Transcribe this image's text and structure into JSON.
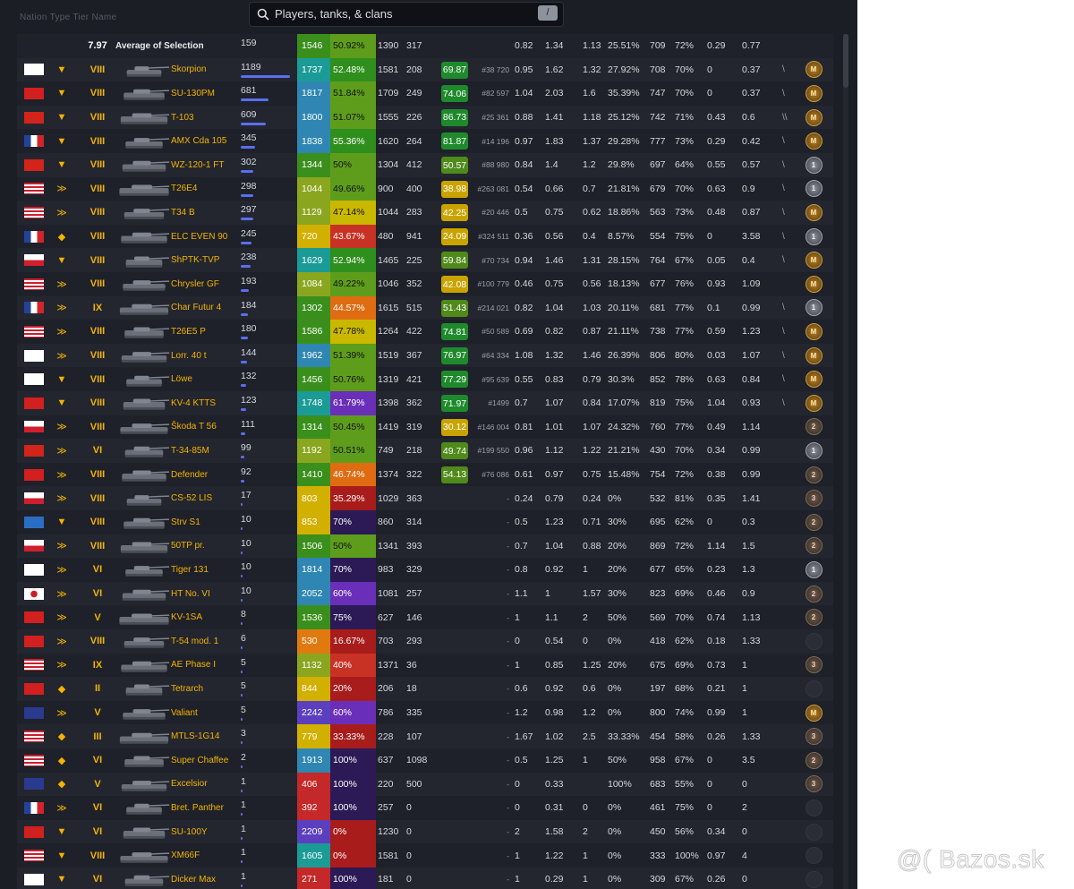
{
  "header": {
    "faint_text": "Nation  Type  Tier  Name",
    "search_placeholder": "Players, tanks, & clans",
    "search_shortcut": "/"
  },
  "average": {
    "tier": "7.97",
    "label": "Average of Selection",
    "battles": "159",
    "wn8": "1546",
    "winrate": "50.92%",
    "dmg": "1390",
    "xp": "317",
    "s1": "0.82",
    "s2": "1.34",
    "s3": "1.13",
    "s4": "25.51%",
    "s5": "709",
    "s6": "72%",
    "s7": "0.29",
    "s8": "0.77"
  },
  "watermark": "@( Bazos.sk",
  "rows": [
    {
      "flag": "ger",
      "cls": "heavy",
      "tier": "VIII",
      "name": "Skorpion",
      "battles": "1189",
      "bar": 1.0,
      "wn8": "1737",
      "wr": "52.48%",
      "dmg": "1581",
      "xp": "208",
      "moe": "69.87",
      "rank": "#38 720",
      "s1": "0.95",
      "s2": "1.62",
      "s3": "1.32",
      "s4": "27.92%",
      "s5": "708",
      "s6": "70%",
      "s7": "0",
      "s8": "0.37",
      "ind": "\\",
      "medal": "gold",
      "mlabel": "M"
    },
    {
      "flag": "ussr",
      "cls": "heavy",
      "tier": "VIII",
      "name": "SU-130PM",
      "battles": "681",
      "bar": 0.57,
      "wn8": "1817",
      "wr": "51.84%",
      "dmg": "1709",
      "xp": "249",
      "moe": "74.06",
      "rank": "#82 597",
      "s1": "1.04",
      "s2": "2.03",
      "s3": "1.6",
      "s4": "35.39%",
      "s5": "747",
      "s6": "70%",
      "s7": "0",
      "s8": "0.37",
      "ind": "\\",
      "medal": "gold",
      "mlabel": "M"
    },
    {
      "flag": "china",
      "cls": "heavy",
      "tier": "VIII",
      "name": "T-103",
      "battles": "609",
      "bar": 0.51,
      "wn8": "1800",
      "wr": "51.07%",
      "dmg": "1555",
      "xp": "226",
      "moe": "86.73",
      "rank": "#25 361",
      "s1": "0.88",
      "s2": "1.41",
      "s3": "1.18",
      "s4": "25.12%",
      "s5": "742",
      "s6": "71%",
      "s7": "0.43",
      "s8": "0.6",
      "ind": "\\\\",
      "medal": "gold",
      "mlabel": "M"
    },
    {
      "flag": "france",
      "cls": "heavy",
      "tier": "VIII",
      "name": "AMX Cda 105",
      "battles": "345",
      "bar": 0.29,
      "wn8": "1838",
      "wr": "55.36%",
      "dmg": "1620",
      "xp": "264",
      "moe": "81.87",
      "rank": "#14 196",
      "s1": "0.97",
      "s2": "1.83",
      "s3": "1.37",
      "s4": "29.28%",
      "s5": "777",
      "s6": "73%",
      "s7": "0.29",
      "s8": "0.42",
      "ind": "\\",
      "medal": "gold",
      "mlabel": "M"
    },
    {
      "flag": "china",
      "cls": "heavy",
      "tier": "VIII",
      "name": "WZ-120-1 FT",
      "battles": "302",
      "bar": 0.25,
      "wn8": "1344",
      "wr": "50%",
      "dmg": "1304",
      "xp": "412",
      "moe": "50.57",
      "rank": "#88 980",
      "s1": "0.84",
      "s2": "1.4",
      "s3": "1.2",
      "s4": "29.8%",
      "s5": "697",
      "s6": "64%",
      "s7": "0.55",
      "s8": "0.57",
      "ind": "\\",
      "medal": "silver",
      "mlabel": "1"
    },
    {
      "flag": "usa",
      "cls": "medium",
      "tier": "VIII",
      "name": "T26E4",
      "battles": "298",
      "bar": 0.25,
      "wn8": "1044",
      "wr": "49.66%",
      "dmg": "900",
      "xp": "400",
      "moe": "38.98",
      "rank": "#263 081",
      "s1": "0.54",
      "s2": "0.66",
      "s3": "0.7",
      "s4": "21.81%",
      "s5": "679",
      "s6": "70%",
      "s7": "0.63",
      "s8": "0.9",
      "ind": "\\",
      "medal": "silver",
      "mlabel": "1"
    },
    {
      "flag": "usa",
      "cls": "medium",
      "tier": "VIII",
      "name": "T34 B",
      "battles": "297",
      "bar": 0.25,
      "wn8": "1129",
      "wr": "47.14%",
      "dmg": "1044",
      "xp": "283",
      "moe": "42.25",
      "rank": "#20 446",
      "s1": "0.5",
      "s2": "0.75",
      "s3": "0.62",
      "s4": "18.86%",
      "s5": "563",
      "s6": "73%",
      "s7": "0.48",
      "s8": "0.87",
      "ind": "\\",
      "medal": "gold",
      "mlabel": "M"
    },
    {
      "flag": "france",
      "cls": "light",
      "tier": "VIII",
      "name": "ELC EVEN 90",
      "battles": "245",
      "bar": 0.21,
      "wn8": "720",
      "wr": "43.67%",
      "dmg": "480",
      "xp": "941",
      "moe": "24.09",
      "rank": "#324 511",
      "s1": "0.36",
      "s2": "0.56",
      "s3": "0.4",
      "s4": "8.57%",
      "s5": "554",
      "s6": "75%",
      "s7": "0",
      "s8": "3.58",
      "ind": "\\",
      "medal": "silver",
      "mlabel": "1"
    },
    {
      "flag": "czech",
      "cls": "heavy",
      "tier": "VIII",
      "name": "ShPTK-TVP",
      "battles": "238",
      "bar": 0.2,
      "wn8": "1629",
      "wr": "52.94%",
      "dmg": "1465",
      "xp": "225",
      "moe": "59.84",
      "rank": "#70 734",
      "s1": "0.94",
      "s2": "1.46",
      "s3": "1.31",
      "s4": "28.15%",
      "s5": "764",
      "s6": "67%",
      "s7": "0.05",
      "s8": "0.4",
      "ind": "\\",
      "medal": "gold",
      "mlabel": "M"
    },
    {
      "flag": "usa",
      "cls": "medium",
      "tier": "VIII",
      "name": "Chrysler GF",
      "battles": "193",
      "bar": 0.16,
      "wn8": "1084",
      "wr": "49.22%",
      "dmg": "1046",
      "xp": "352",
      "moe": "42.08",
      "rank": "#100 779",
      "s1": "0.46",
      "s2": "0.75",
      "s3": "0.56",
      "s4": "18.13%",
      "s5": "677",
      "s6": "76%",
      "s7": "0.93",
      "s8": "1.09",
      "ind": "",
      "medal": "gold",
      "mlabel": "M"
    },
    {
      "flag": "france",
      "cls": "medium",
      "tier": "IX",
      "name": "Char Futur 4",
      "battles": "184",
      "bar": 0.15,
      "wn8": "1302",
      "wr": "44.57%",
      "dmg": "1615",
      "xp": "515",
      "moe": "51.43",
      "rank": "#214 021",
      "s1": "0.82",
      "s2": "1.04",
      "s3": "1.03",
      "s4": "20.11%",
      "s5": "681",
      "s6": "77%",
      "s7": "0.1",
      "s8": "0.99",
      "ind": "\\",
      "medal": "silver",
      "mlabel": "1"
    },
    {
      "flag": "usa",
      "cls": "medium",
      "tier": "VIII",
      "name": "T26E5 P",
      "battles": "180",
      "bar": 0.15,
      "wn8": "1586",
      "wr": "47.78%",
      "dmg": "1264",
      "xp": "422",
      "moe": "74.81",
      "rank": "#50 589",
      "s1": "0.69",
      "s2": "0.82",
      "s3": "0.87",
      "s4": "21.11%",
      "s5": "738",
      "s6": "77%",
      "s7": "0.59",
      "s8": "1.23",
      "ind": "\\",
      "medal": "gold",
      "mlabel": "M"
    },
    {
      "flag": "ger",
      "cls": "medium",
      "tier": "VIII",
      "name": "Lorr. 40 t",
      "battles": "144",
      "bar": 0.12,
      "wn8": "1962",
      "wr": "51.39%",
      "dmg": "1519",
      "xp": "367",
      "moe": "76.97",
      "rank": "#64 334",
      "s1": "1.08",
      "s2": "1.32",
      "s3": "1.46",
      "s4": "26.39%",
      "s5": "806",
      "s6": "80%",
      "s7": "0.03",
      "s8": "1.07",
      "ind": "\\",
      "medal": "gold",
      "mlabel": "M"
    },
    {
      "flag": "ger",
      "cls": "heavy",
      "tier": "VIII",
      "name": "Löwe",
      "battles": "132",
      "bar": 0.11,
      "wn8": "1456",
      "wr": "50.76%",
      "dmg": "1319",
      "xp": "421",
      "moe": "77.29",
      "rank": "#95 639",
      "s1": "0.55",
      "s2": "0.83",
      "s3": "0.79",
      "s4": "30.3%",
      "s5": "852",
      "s6": "78%",
      "s7": "0.63",
      "s8": "0.84",
      "ind": "\\",
      "medal": "gold",
      "mlabel": "M"
    },
    {
      "flag": "ussr",
      "cls": "heavy",
      "tier": "VIII",
      "name": "KV-4 KTTS",
      "battles": "123",
      "bar": 0.1,
      "wn8": "1748",
      "wr": "61.79%",
      "dmg": "1398",
      "xp": "362",
      "moe": "71.97",
      "rank": "#1499",
      "s1": "0.7",
      "s2": "1.07",
      "s3": "0.84",
      "s4": "17.07%",
      "s5": "819",
      "s6": "75%",
      "s7": "1.04",
      "s8": "0.93",
      "ind": "\\",
      "medal": "gold",
      "mlabel": "M"
    },
    {
      "flag": "czech",
      "cls": "medium",
      "tier": "VIII",
      "name": "Škoda T 56",
      "battles": "111",
      "bar": 0.09,
      "wn8": "1314",
      "wr": "50.45%",
      "dmg": "1419",
      "xp": "319",
      "moe": "30.12",
      "rank": "#146 004",
      "s1": "0.81",
      "s2": "1.01",
      "s3": "1.07",
      "s4": "24.32%",
      "s5": "760",
      "s6": "77%",
      "s7": "0.49",
      "s8": "1.14",
      "ind": "",
      "medal": "bronze",
      "mlabel": "2"
    },
    {
      "flag": "china",
      "cls": "medium",
      "tier": "VI",
      "name": "T-34-85M",
      "battles": "99",
      "bar": 0.08,
      "wn8": "1192",
      "wr": "50.51%",
      "dmg": "749",
      "xp": "218",
      "moe": "49.74",
      "rank": "#199 550",
      "s1": "0.96",
      "s2": "1.12",
      "s3": "1.22",
      "s4": "21.21%",
      "s5": "430",
      "s6": "70%",
      "s7": "0.34",
      "s8": "0.99",
      "ind": "",
      "medal": "silver",
      "mlabel": "1"
    },
    {
      "flag": "ussr",
      "cls": "medium",
      "tier": "VIII",
      "name": "Defender",
      "battles": "92",
      "bar": 0.08,
      "wn8": "1410",
      "wr": "46.74%",
      "dmg": "1374",
      "xp": "322",
      "moe": "54.13",
      "rank": "#76 086",
      "s1": "0.61",
      "s2": "0.97",
      "s3": "0.75",
      "s4": "15.48%",
      "s5": "754",
      "s6": "72%",
      "s7": "0.38",
      "s8": "0.99",
      "ind": "",
      "medal": "bronze",
      "mlabel": "2"
    },
    {
      "flag": "poland",
      "cls": "medium",
      "tier": "VIII",
      "name": "CS-52 LIS",
      "battles": "17",
      "bar": 0.015,
      "wn8": "803",
      "wr": "35.29%",
      "dmg": "1029",
      "xp": "363",
      "moe": "",
      "rank": "-",
      "s1": "0.24",
      "s2": "0.79",
      "s3": "0.24",
      "s4": "0%",
      "s5": "532",
      "s6": "81%",
      "s7": "0.35",
      "s8": "1.41",
      "ind": "",
      "medal": "bronze",
      "mlabel": "3"
    },
    {
      "flag": "sweden",
      "cls": "heavy",
      "tier": "VIII",
      "name": "Strv S1",
      "battles": "10",
      "bar": 0.008,
      "wn8": "853",
      "wr": "70%",
      "dmg": "860",
      "xp": "314",
      "moe": "",
      "rank": "-",
      "s1": "0.5",
      "s2": "1.23",
      "s3": "0.71",
      "s4": "30%",
      "s5": "695",
      "s6": "62%",
      "s7": "0",
      "s8": "0.3",
      "ind": "",
      "medal": "bronze",
      "mlabel": "2"
    },
    {
      "flag": "poland",
      "cls": "medium",
      "tier": "VIII",
      "name": "50TP pr.",
      "battles": "10",
      "bar": 0.008,
      "wn8": "1506",
      "wr": "50%",
      "dmg": "1341",
      "xp": "393",
      "moe": "",
      "rank": "-",
      "s1": "0.7",
      "s2": "1.04",
      "s3": "0.88",
      "s4": "20%",
      "s5": "869",
      "s6": "72%",
      "s7": "1.14",
      "s8": "1.5",
      "ind": "",
      "medal": "bronze",
      "mlabel": "2"
    },
    {
      "flag": "ger",
      "cls": "medium",
      "tier": "VI",
      "name": "Tiger 131",
      "battles": "10",
      "bar": 0.008,
      "wn8": "1814",
      "wr": "70%",
      "dmg": "983",
      "xp": "329",
      "moe": "",
      "rank": "-",
      "s1": "0.8",
      "s2": "0.92",
      "s3": "1",
      "s4": "20%",
      "s5": "677",
      "s6": "65%",
      "s7": "0.23",
      "s8": "1.3",
      "ind": "",
      "medal": "silver",
      "mlabel": "1"
    },
    {
      "flag": "japan",
      "cls": "medium",
      "tier": "VI",
      "name": "HT No. VI",
      "battles": "10",
      "bar": 0.008,
      "wn8": "2052",
      "wr": "60%",
      "dmg": "1081",
      "xp": "257",
      "moe": "",
      "rank": "-",
      "s1": "1.1",
      "s2": "1",
      "s3": "1.57",
      "s4": "30%",
      "s5": "823",
      "s6": "69%",
      "s7": "0.46",
      "s8": "0.9",
      "ind": "",
      "medal": "bronze",
      "mlabel": "2"
    },
    {
      "flag": "ussr",
      "cls": "medium",
      "tier": "V",
      "name": "KV-1SA",
      "battles": "8",
      "bar": 0.007,
      "wn8": "1536",
      "wr": "75%",
      "dmg": "627",
      "xp": "146",
      "moe": "",
      "rank": "-",
      "s1": "1",
      "s2": "1.1",
      "s3": "2",
      "s4": "50%",
      "s5": "569",
      "s6": "70%",
      "s7": "0.74",
      "s8": "1.13",
      "ind": "",
      "medal": "bronze",
      "mlabel": "2"
    },
    {
      "flag": "ussr",
      "cls": "medium",
      "tier": "VIII",
      "name": "T-54 mod. 1",
      "battles": "6",
      "bar": 0.005,
      "wn8": "530",
      "wr": "16.67%",
      "dmg": "703",
      "xp": "293",
      "moe": "",
      "rank": "-",
      "s1": "0",
      "s2": "0.54",
      "s3": "0",
      "s4": "0%",
      "s5": "418",
      "s6": "62%",
      "s7": "0.18",
      "s8": "1.33",
      "ind": "",
      "medal": "empty",
      "mlabel": ""
    },
    {
      "flag": "usa",
      "cls": "medium",
      "tier": "IX",
      "name": "AE Phase I",
      "battles": "5",
      "bar": 0.004,
      "wn8": "1132",
      "wr": "40%",
      "dmg": "1371",
      "xp": "36",
      "moe": "",
      "rank": "-",
      "s1": "1",
      "s2": "0.85",
      "s3": "1.25",
      "s4": "20%",
      "s5": "675",
      "s6": "69%",
      "s7": "0.73",
      "s8": "1",
      "ind": "",
      "medal": "bronze",
      "mlabel": "3"
    },
    {
      "flag": "ussr",
      "cls": "light",
      "tier": "II",
      "name": "Tetrarch",
      "battles": "5",
      "bar": 0.004,
      "wn8": "844",
      "wr": "20%",
      "dmg": "206",
      "xp": "18",
      "moe": "",
      "rank": "-",
      "s1": "0.6",
      "s2": "0.92",
      "s3": "0.6",
      "s4": "0%",
      "s5": "197",
      "s6": "68%",
      "s7": "0.21",
      "s8": "1",
      "ind": "",
      "medal": "empty",
      "mlabel": ""
    },
    {
      "flag": "uk",
      "cls": "medium",
      "tier": "V",
      "name": "Valiant",
      "battles": "5",
      "bar": 0.004,
      "wn8": "2242",
      "wr": "60%",
      "dmg": "786",
      "xp": "335",
      "moe": "",
      "rank": "-",
      "s1": "1.2",
      "s2": "0.98",
      "s3": "1.2",
      "s4": "0%",
      "s5": "800",
      "s6": "74%",
      "s7": "0.99",
      "s8": "1",
      "ind": "",
      "medal": "gold",
      "mlabel": "M"
    },
    {
      "flag": "usa",
      "cls": "light",
      "tier": "III",
      "name": "MTLS-1G14",
      "battles": "3",
      "bar": 0.003,
      "wn8": "779",
      "wr": "33.33%",
      "dmg": "228",
      "xp": "107",
      "moe": "",
      "rank": "-",
      "s1": "1.67",
      "s2": "1.02",
      "s3": "2.5",
      "s4": "33.33%",
      "s5": "454",
      "s6": "58%",
      "s7": "0.26",
      "s8": "1.33",
      "ind": "",
      "medal": "bronze",
      "mlabel": "3"
    },
    {
      "flag": "usa",
      "cls": "light",
      "tier": "VI",
      "name": "Super Chaffee",
      "battles": "2",
      "bar": 0.002,
      "wn8": "1913",
      "wr": "100%",
      "dmg": "637",
      "xp": "1098",
      "moe": "",
      "rank": "-",
      "s1": "0.5",
      "s2": "1.25",
      "s3": "1",
      "s4": "50%",
      "s5": "958",
      "s6": "67%",
      "s7": "0",
      "s8": "3.5",
      "ind": "",
      "medal": "bronze",
      "mlabel": "2"
    },
    {
      "flag": "uk",
      "cls": "light",
      "tier": "V",
      "name": "Excelsior",
      "battles": "1",
      "bar": 0.001,
      "wn8": "406",
      "wr": "100%",
      "dmg": "220",
      "xp": "500",
      "moe": "",
      "rank": "-",
      "s1": "0",
      "s2": "0.33",
      "s3": "",
      "s4": "100%",
      "s5": "683",
      "s6": "55%",
      "s7": "0",
      "s8": "0",
      "ind": "",
      "medal": "bronze",
      "mlabel": "3"
    },
    {
      "flag": "france",
      "cls": "medium",
      "tier": "VI",
      "name": "Bret. Panther",
      "battles": "1",
      "bar": 0.001,
      "wn8": "392",
      "wr": "100%",
      "dmg": "257",
      "xp": "0",
      "moe": "",
      "rank": "-",
      "s1": "0",
      "s2": "0.31",
      "s3": "0",
      "s4": "0%",
      "s5": "461",
      "s6": "75%",
      "s7": "0",
      "s8": "2",
      "ind": "",
      "medal": "empty",
      "mlabel": ""
    },
    {
      "flag": "ussr",
      "cls": "heavy",
      "tier": "VI",
      "name": "SU-100Y",
      "battles": "1",
      "bar": 0.001,
      "wn8": "2209",
      "wr": "0%",
      "dmg": "1230",
      "xp": "0",
      "moe": "",
      "rank": "-",
      "s1": "2",
      "s2": "1.58",
      "s3": "2",
      "s4": "0%",
      "s5": "450",
      "s6": "56%",
      "s7": "0.34",
      "s8": "0",
      "ind": "",
      "medal": "empty",
      "mlabel": ""
    },
    {
      "flag": "usa",
      "cls": "heavy",
      "tier": "VIII",
      "name": "XM66F",
      "battles": "1",
      "bar": 0.001,
      "wn8": "1605",
      "wr": "0%",
      "dmg": "1581",
      "xp": "0",
      "moe": "",
      "rank": "-",
      "s1": "1",
      "s2": "1.22",
      "s3": "1",
      "s4": "0%",
      "s5": "333",
      "s6": "100%",
      "s7": "0.97",
      "s8": "4",
      "ind": "",
      "medal": "empty",
      "mlabel": ""
    },
    {
      "flag": "ger",
      "cls": "heavy",
      "tier": "VI",
      "name": "Dicker Max",
      "battles": "1",
      "bar": 0.001,
      "wn8": "271",
      "wr": "100%",
      "dmg": "181",
      "xp": "0",
      "moe": "",
      "rank": "-",
      "s1": "1",
      "s2": "0.29",
      "s3": "1",
      "s4": "0%",
      "s5": "309",
      "s6": "67%",
      "s7": "0.26",
      "s8": "0",
      "ind": "",
      "medal": "empty",
      "mlabel": ""
    }
  ]
}
